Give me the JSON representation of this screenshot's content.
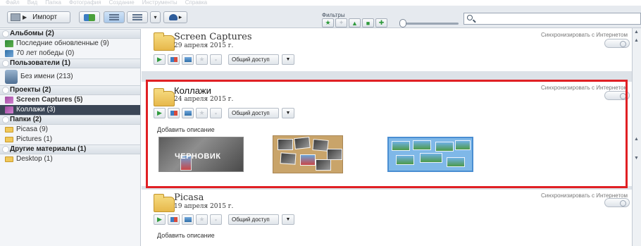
{
  "menubar": [
    "Файл",
    "Вид",
    "Папка",
    "Фотография",
    "Создание",
    "Инструменты",
    "Справка"
  ],
  "toolbar": {
    "import_label": "Импорт",
    "filters_label": "Фильтры",
    "search": {
      "value": "",
      "placeholder": ""
    },
    "filter_buttons": [
      "star-icon",
      "people-icon",
      "person-icon",
      "video-icon",
      "geotag-icon"
    ]
  },
  "sidebar": {
    "albums_header": "Альбомы (2)",
    "albums": [
      "Последние обновленные (9)",
      "70 лет победы (0)"
    ],
    "users_header": "Пользователи (1)",
    "users": [
      "Без имени (213)"
    ],
    "projects_header": "Проекты (2)",
    "projects": [
      "Screen Captures (5)",
      "Коллажи (3)"
    ],
    "folders_header": "Папки (2)",
    "folders": [
      "Picasa (9)",
      "Pictures (1)"
    ],
    "other_header": "Другие материалы (1)",
    "other": [
      "Desktop (1)"
    ]
  },
  "cards": [
    {
      "title": "Screen Captures",
      "date": "29 апреля 2015 г.",
      "sync": "Синхронизировать с Интернетом",
      "share": "Общий доступ"
    },
    {
      "title": "Коллажи",
      "date": "24 апреля 2015 г.",
      "sync": "Синхронизировать с Интернетом",
      "share": "Общий доступ",
      "description": "Добавить описание",
      "draft_label": "ЧЕРНОВИК"
    },
    {
      "title": "Picasa",
      "date": "19 апреля 2015 г.",
      "sync": "Синхронизировать с Интернетом",
      "share": "Общий доступ",
      "description": "Добавить описание"
    }
  ],
  "colors": {
    "highlight": "#e02024",
    "selection": "#3b4656",
    "background": "#dde2e8"
  }
}
